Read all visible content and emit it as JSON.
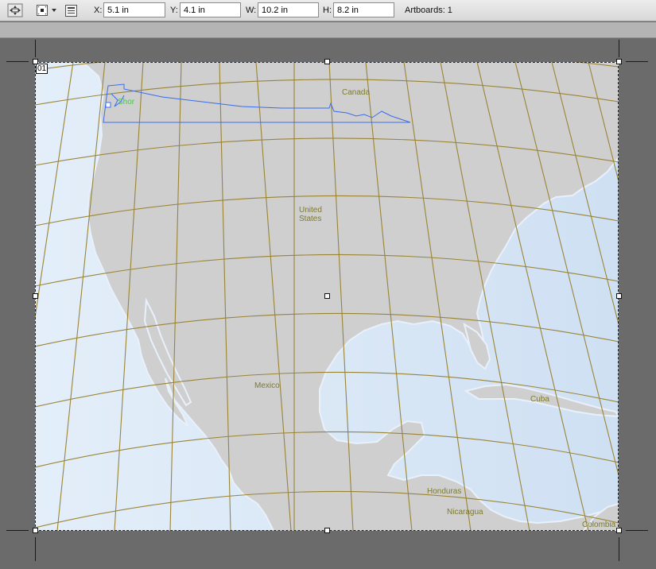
{
  "control_bar": {
    "x_label": "X:",
    "x_value": "5.1 in",
    "y_label": "Y:",
    "y_value": "4.1 in",
    "w_label": "W:",
    "w_value": "10.2 in",
    "h_label": "H:",
    "h_value": "8.2 in",
    "artboards_text": "Artboards: 1",
    "icons": [
      "move-artboard-icon",
      "reference-point-icon",
      "dropdown-arrow-icon",
      "artboard-options-icon"
    ]
  },
  "artboard": {
    "number": "01"
  },
  "map": {
    "labels": {
      "canada": "Canada",
      "united_states_line1": "United",
      "united_states_line2": "States",
      "mexico": "Mexico",
      "cuba": "Cuba",
      "honduras": "Honduras",
      "nicaragua": "Nicaragua",
      "colombia": "Colombia",
      "selected_text": "Shor"
    },
    "colors": {
      "land": "#cfcfcf",
      "ocean": "#dbe8f5",
      "graticule": "#9a8436",
      "label": "#7d7a2c",
      "selection": "#3a6cf0"
    }
  }
}
